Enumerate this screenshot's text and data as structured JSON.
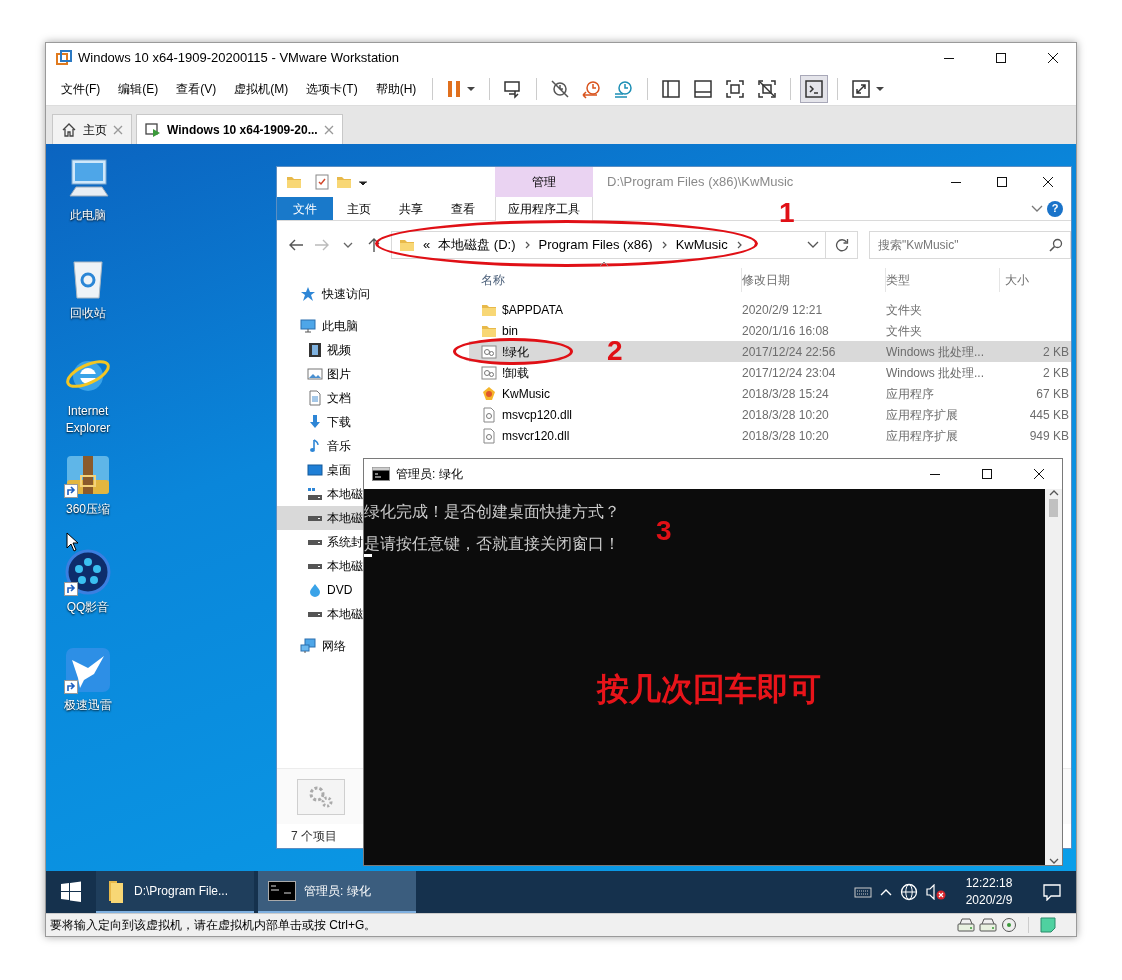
{
  "window": {
    "title": "Windows 10 x64-1909-20200115 - VMware Workstation"
  },
  "menu": [
    "文件(F)",
    "编辑(E)",
    "查看(V)",
    "虚拟机(M)",
    "选项卡(T)",
    "帮助(H)"
  ],
  "toolbar": [
    {
      "items": [
        {
          "kind": "pause",
          "selected": false
        }
      ]
    },
    {
      "items": [
        {
          "kind": "send",
          "selected": false
        }
      ]
    },
    {
      "items": [
        {
          "kind": "snapshot-off",
          "selected": false
        },
        {
          "kind": "revert",
          "selected": false
        },
        {
          "kind": "snapshot-manager",
          "selected": false
        }
      ]
    },
    {
      "items": [
        {
          "kind": "library",
          "selected": false
        },
        {
          "kind": "thumbnail",
          "selected": false
        },
        {
          "kind": "fit",
          "selected": false
        },
        {
          "kind": "unity",
          "selected": false
        }
      ]
    },
    {
      "items": [
        {
          "kind": "console",
          "selected": true
        }
      ]
    },
    {
      "items": [
        {
          "kind": "fullscreen",
          "selected": false
        }
      ]
    }
  ],
  "tabs": [
    {
      "label": "主页",
      "kind": "home",
      "selected": false
    },
    {
      "label": "Windows 10 x64-1909-20...",
      "kind": "vm",
      "selected": true
    }
  ],
  "desktop_icons": [
    {
      "label": "此电脑",
      "kind": "pc",
      "shortcut": false
    },
    {
      "label": "回收站",
      "kind": "recycle-bin",
      "shortcut": false
    },
    {
      "label": "Internet Explorer",
      "kind": "browser",
      "shortcut": false
    },
    {
      "label": "360压缩",
      "kind": "archive",
      "shortcut": true
    },
    {
      "label": "QQ影音",
      "kind": "player",
      "shortcut": true
    },
    {
      "label": "极速迅雷",
      "kind": "bird",
      "shortcut": true
    }
  ],
  "explorer": {
    "contextual_group": "管理",
    "title": "D:\\Program Files (x86)\\KwMusic",
    "ribbon_tabs": [
      {
        "label": "文件",
        "kind": "file"
      },
      {
        "label": "主页",
        "kind": "tab"
      },
      {
        "label": "共享",
        "kind": "tab"
      },
      {
        "label": "查看",
        "kind": "tab"
      },
      {
        "label": "应用程序工具",
        "kind": "contextual"
      }
    ],
    "help": "?",
    "address": {
      "overflow": "«",
      "crumbs": [
        "本地磁盘 (D:)",
        "Program Files (x86)",
        "KwMusic"
      ],
      "circled": true,
      "note": "1"
    },
    "search": {
      "placeholder": "搜索\"KwMusic\""
    },
    "nav": [
      {
        "label": "快速访问",
        "kind": "star",
        "selected": false
      },
      {
        "label": "此电脑",
        "kind": "pc",
        "selected": false,
        "children": [
          {
            "label": "视频",
            "kind": "video",
            "selected": false
          },
          {
            "label": "图片",
            "kind": "picture",
            "selected": false
          },
          {
            "label": "文档",
            "kind": "document",
            "selected": false
          },
          {
            "label": "下载",
            "kind": "download",
            "selected": false
          },
          {
            "label": "音乐",
            "kind": "music",
            "selected": false
          },
          {
            "label": "桌面",
            "kind": "desktop",
            "selected": false
          },
          {
            "label": "本地磁",
            "kind": "drive-sys",
            "selected": false
          },
          {
            "label": "本地磁",
            "kind": "drive",
            "selected": true
          },
          {
            "label": "系统封",
            "kind": "drive",
            "selected": false
          },
          {
            "label": "本地磁",
            "kind": "drive",
            "selected": false
          },
          {
            "label": "DVD",
            "kind": "dvd",
            "selected": false
          },
          {
            "label": "本地磁",
            "kind": "drive",
            "selected": false
          }
        ]
      },
      {
        "label": "网络",
        "kind": "network",
        "selected": false
      }
    ],
    "columns": [
      {
        "label": "名称",
        "sorted": true
      },
      {
        "label": "修改日期",
        "sorted": false
      },
      {
        "label": "类型",
        "sorted": false
      },
      {
        "label": "大小",
        "sorted": false
      }
    ],
    "files": [
      {
        "name": "$APPDATA",
        "date": "2020/2/9 12:21",
        "type": "文件夹",
        "kind": "folder",
        "selected": false,
        "circled": false
      },
      {
        "name": "bin",
        "date": "2020/1/16 16:08",
        "type": "文件夹",
        "kind": "folder",
        "selected": false,
        "circled": false
      },
      {
        "name": "!绿化",
        "date": "2017/12/24 22:56",
        "type": "Windows 批处理...",
        "size": "2 KB",
        "kind": "batch",
        "selected": true,
        "circled": true,
        "note": "2"
      },
      {
        "name": "!卸载",
        "date": "2017/12/24 23:04",
        "type": "Windows 批处理...",
        "size": "2 KB",
        "kind": "batch",
        "selected": false,
        "circled": false
      },
      {
        "name": "KwMusic",
        "date": "2018/3/28 15:24",
        "type": "应用程序",
        "size": "67 KB",
        "kind": "app",
        "selected": false,
        "circled": false
      },
      {
        "name": "msvcp120.dll",
        "date": "2018/3/28 10:20",
        "type": "应用程序扩展",
        "size": "445 KB",
        "kind": "dll",
        "selected": false,
        "circled": false
      },
      {
        "name": "msvcr120.dll",
        "date": "2018/3/28 10:20",
        "type": "应用程序扩展",
        "size": "949 KB",
        "kind": "dll",
        "selected": false,
        "circled": false
      }
    ],
    "status": "7 个项目"
  },
  "console": {
    "title": "管理员: 绿化",
    "lines": [
      "绿化完成！是否创建桌面快捷方式？",
      "是请按任意键，否就直接关闭窗口！"
    ],
    "cursor": true,
    "note": "3",
    "callout": "按几次回车即可"
  },
  "taskbar": {
    "apps": [
      {
        "label": "D:\\Program File...",
        "kind": "folder",
        "selected": false
      },
      {
        "label": "管理员: 绿化",
        "kind": "console",
        "selected": true
      }
    ],
    "muted": true,
    "time": "12:22:18",
    "date": "2020/2/9"
  },
  "status_bar": {
    "message": "要将输入定向到该虚拟机，请在虚拟机内部单击或按 Ctrl+G。"
  }
}
